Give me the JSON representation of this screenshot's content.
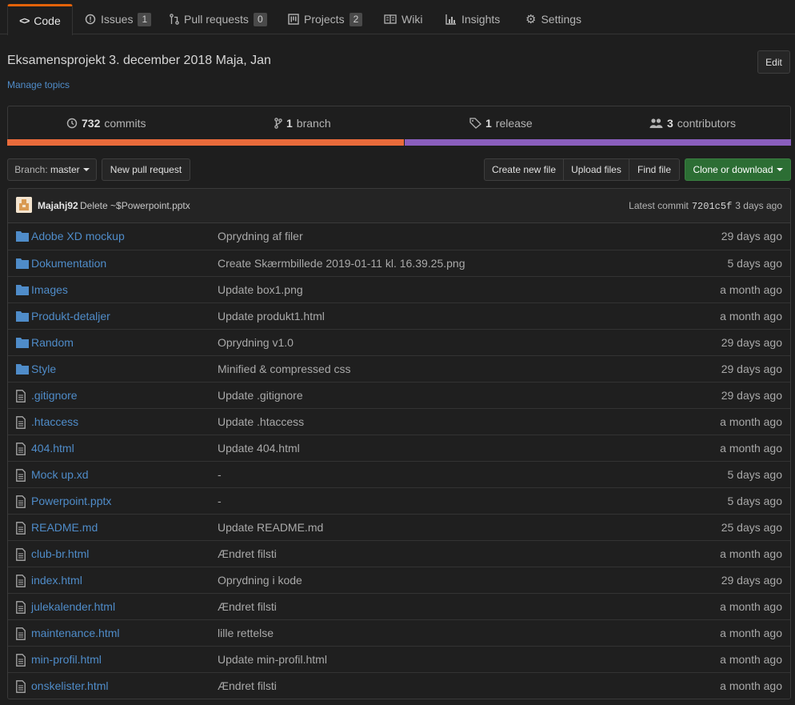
{
  "tabs": [
    {
      "label": "Code",
      "icon": "code-icon"
    },
    {
      "label": "Issues",
      "icon": "issue-icon",
      "count": "1"
    },
    {
      "label": "Pull requests",
      "icon": "pull-request-icon",
      "count": "0"
    },
    {
      "label": "Projects",
      "icon": "project-icon",
      "count": "2"
    },
    {
      "label": "Wiki",
      "icon": "book-icon"
    },
    {
      "label": "Insights",
      "icon": "graph-icon"
    },
    {
      "label": "Settings",
      "icon": "gear-icon"
    }
  ],
  "repo": {
    "description": "Eksamensprojekt 3. december 2018 Maja, Jan",
    "manage_topics": "Manage topics",
    "edit_label": "Edit"
  },
  "summary": {
    "commits_count": "732",
    "commits_label": "commits",
    "branch_count": "1",
    "branch_label": "branch",
    "release_count": "1",
    "release_label": "release",
    "contributors_count": "3",
    "contributors_label": "contributors"
  },
  "languages": [
    {
      "color": "#e96b3b",
      "share": 0.506
    },
    {
      "color": "#8a5ebd",
      "share": 0.494
    }
  ],
  "file_nav": {
    "branch_prefix": "Branch:",
    "branch_name": "master",
    "new_pr": "New pull request",
    "create_file": "Create new file",
    "upload_files": "Upload files",
    "find_file": "Find file",
    "clone": "Clone or download"
  },
  "commit": {
    "author": "Majahj92",
    "message": "Delete ~$Powerpoint.pptx",
    "latest_label": "Latest commit",
    "sha": "7201c5f",
    "age": "3 days ago"
  },
  "colors": {
    "accent_tab": "#e36209",
    "link": "#4f8cc9",
    "folder": "#4f8cc9",
    "green_button": "#2c6e34"
  },
  "files": [
    {
      "type": "dir",
      "name": "Adobe XD mockup",
      "message": "Oprydning af filer",
      "age": "29 days ago"
    },
    {
      "type": "dir",
      "name": "Dokumentation",
      "message": "Create Skærmbillede 2019-01-11 kl. 16.39.25.png",
      "age": "5 days ago"
    },
    {
      "type": "dir",
      "name": "Images",
      "message": "Update box1.png",
      "age": "a month ago"
    },
    {
      "type": "dir",
      "name": "Produkt-detaljer",
      "message": "Update produkt1.html",
      "age": "a month ago"
    },
    {
      "type": "dir",
      "name": "Random",
      "message": "Oprydning v1.0",
      "age": "29 days ago"
    },
    {
      "type": "dir",
      "name": "Style",
      "message": "Minified & compressed css",
      "age": "29 days ago"
    },
    {
      "type": "file",
      "name": ".gitignore",
      "message": "Update .gitignore",
      "age": "29 days ago"
    },
    {
      "type": "file",
      "name": ".htaccess",
      "message": "Update .htaccess",
      "age": "a month ago"
    },
    {
      "type": "file",
      "name": "404.html",
      "message": "Update 404.html",
      "age": "a month ago"
    },
    {
      "type": "file",
      "name": "Mock up.xd",
      "message": "-",
      "age": "5 days ago"
    },
    {
      "type": "file",
      "name": "Powerpoint.pptx",
      "message": "-",
      "age": "5 days ago"
    },
    {
      "type": "file",
      "name": "README.md",
      "message": "Update README.md",
      "age": "25 days ago"
    },
    {
      "type": "file",
      "name": "club-br.html",
      "message": "Ændret filsti",
      "age": "a month ago"
    },
    {
      "type": "file",
      "name": "index.html",
      "message": "Oprydning i kode",
      "age": "29 days ago"
    },
    {
      "type": "file",
      "name": "julekalender.html",
      "message": "Ændret filsti",
      "age": "a month ago"
    },
    {
      "type": "file",
      "name": "maintenance.html",
      "message": "lille rettelse",
      "age": "a month ago"
    },
    {
      "type": "file",
      "name": "min-profil.html",
      "message": "Update min-profil.html",
      "age": "a month ago"
    },
    {
      "type": "file",
      "name": "onskelister.html",
      "message": "Ændret filsti",
      "age": "a month ago"
    }
  ]
}
